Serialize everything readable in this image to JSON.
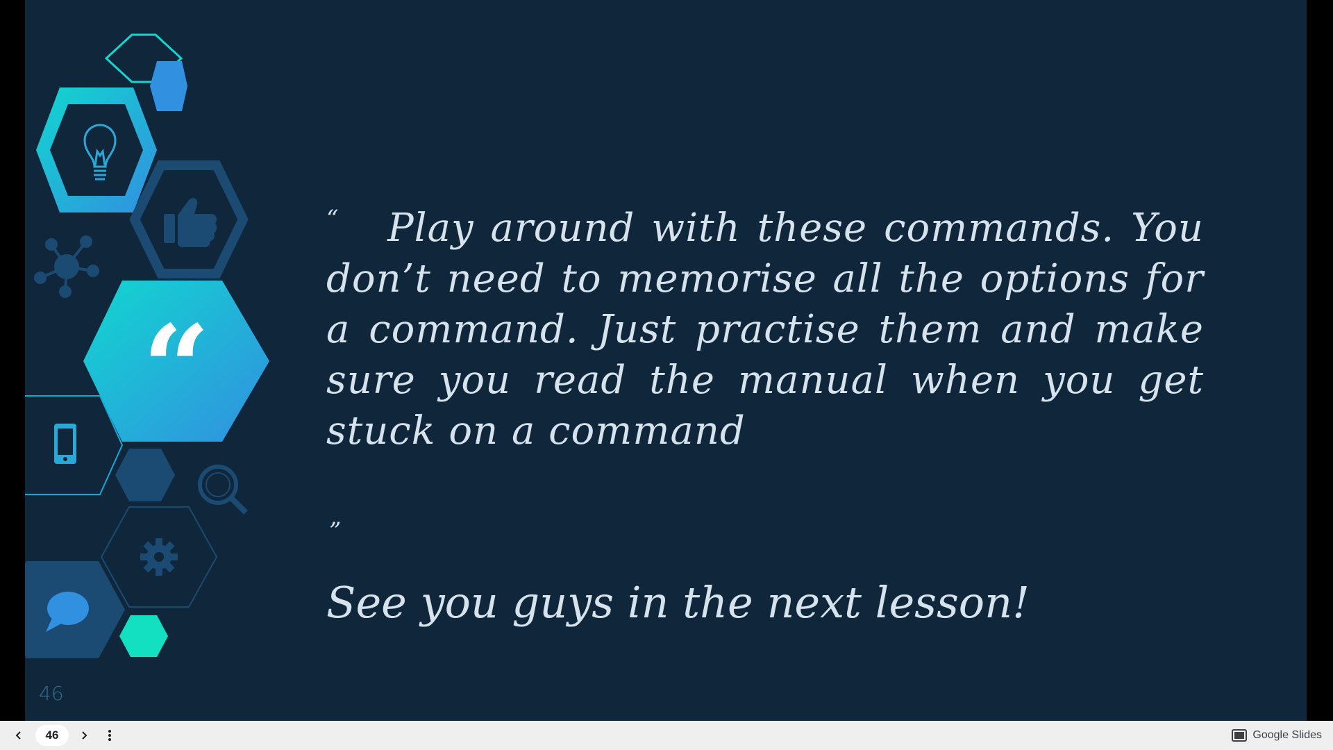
{
  "slide": {
    "quote_open": "“",
    "quote_text": "Play around with these commands. You don’t need to memorise all the options for a command. Just practise them and make sure you read the manual when you get stuck on a command",
    "quote_close": "”",
    "farewell": "See you guys in the next lesson!",
    "slide_number": "46",
    "big_quote_glyph": "“",
    "icons": [
      "lightbulb-icon",
      "thumbs-up-icon",
      "network-icon",
      "quote-icon",
      "phone-icon",
      "search-icon",
      "gear-icon",
      "chat-bubble-icon"
    ],
    "colors": {
      "background": "#0f263b",
      "cyan": "#12d6cf",
      "blue": "#3190e0",
      "navy_hex": "#1b4a72",
      "mint": "#12e0c0",
      "text": "#d6e2ec"
    }
  },
  "toolbar": {
    "page": "46",
    "brand": "Google Slides"
  }
}
